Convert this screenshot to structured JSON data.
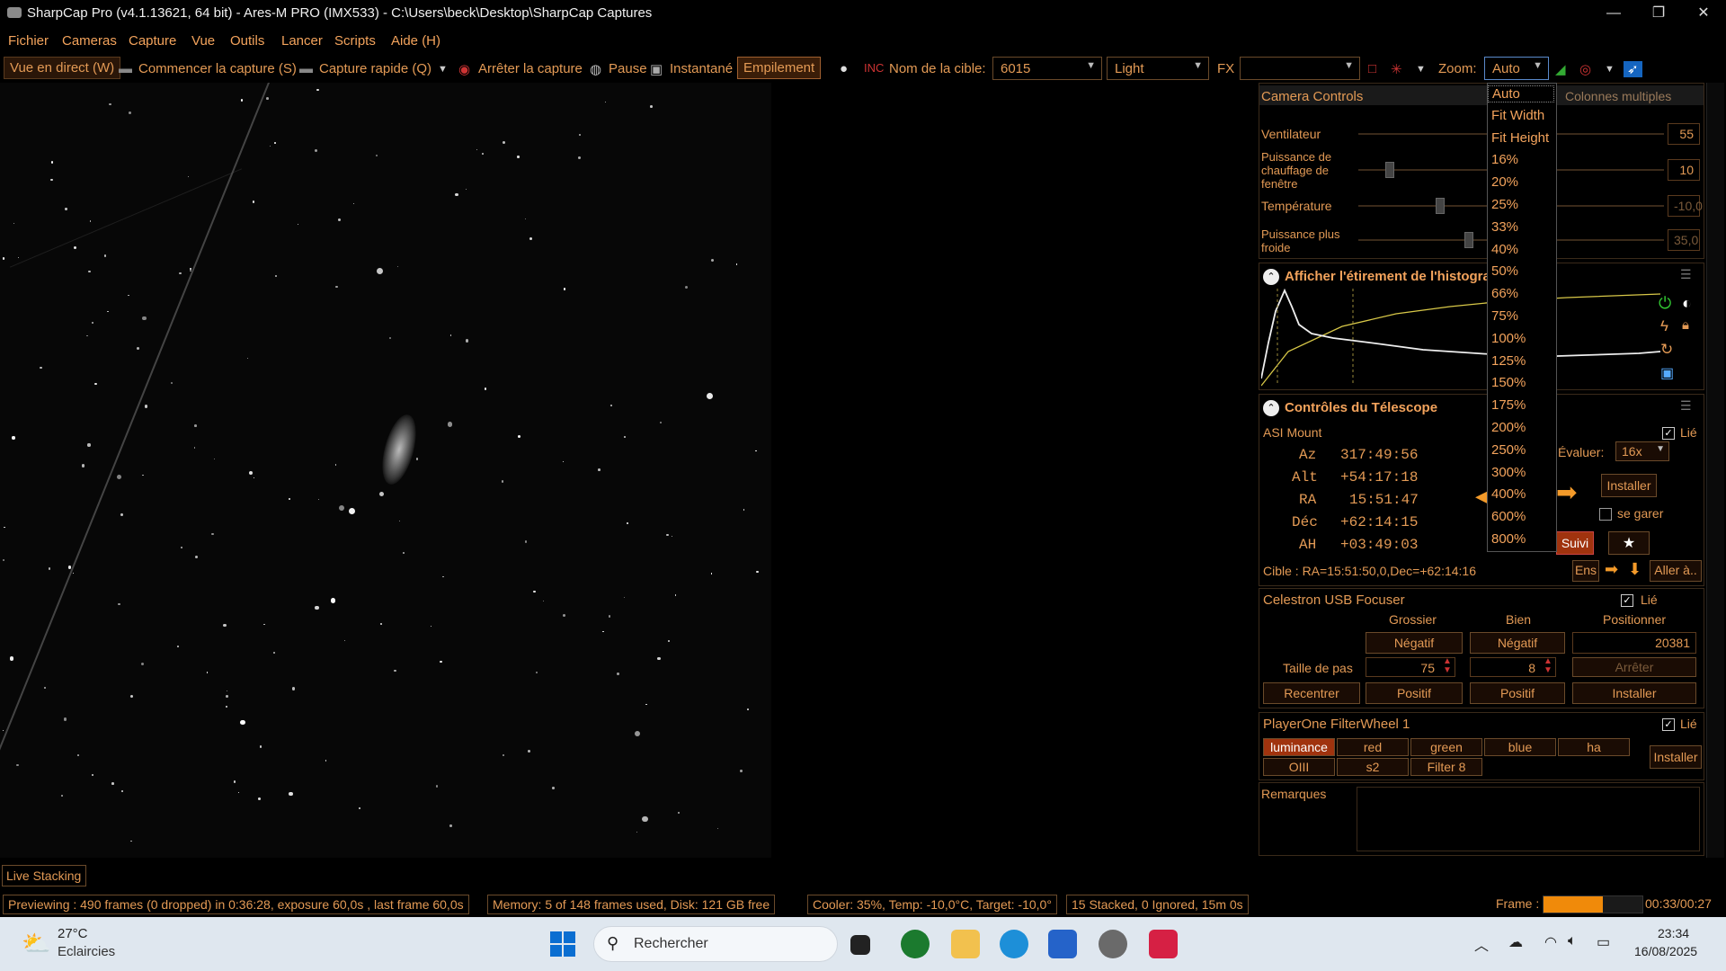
{
  "window": {
    "title": "SharpCap Pro (v4.1.13621, 64 bit) - Ares-M PRO (IMX533) - C:\\Users\\beck\\Desktop\\SharpCap Captures",
    "minimize": "—",
    "maximize": "❐",
    "close": "✕"
  },
  "menu": [
    "Fichier",
    "Cameras",
    "Capture",
    "Vue",
    "Outils",
    "Lancer",
    "Scripts",
    "Aide (H)"
  ],
  "toolbar": {
    "live": "Vue en direct (W)",
    "start_capture": "Commencer la capture (S)",
    "quick_capture": "Capture rapide (Q)",
    "stop_capture": "Arrêter la capture",
    "pause": "Pause",
    "snapshot": "Instantané",
    "stacking": "Empilement",
    "target_label": "Nom de la cible:",
    "target_value": "6015",
    "frame_type": "Light",
    "fx_label": "FX",
    "fx_value": "",
    "zoom_label": "Zoom:",
    "zoom_value": "Auto"
  },
  "zoom_options": [
    "Auto",
    "Fit Width",
    "Fit Height",
    "16%",
    "20%",
    "25%",
    "33%",
    "40%",
    "50%",
    "66%",
    "75%",
    "100%",
    "125%",
    "150%",
    "175%",
    "200%",
    "250%",
    "300%",
    "400%",
    "600%",
    "800%"
  ],
  "camera_controls": {
    "title": "Camera Controls",
    "multi_columns": "Colonnes multiples",
    "fan_label": "Ventilateur",
    "fan_value": "55",
    "window_heater_label": "Puissance de chauffage de fenêtre",
    "window_heater_value": "10",
    "temperature_label": "Température",
    "temperature_value": "-10,0",
    "cooler_label": "Puissance plus froide",
    "cooler_value": "35,0"
  },
  "histogram": {
    "title": "Afficher l'étirement de l'histogram"
  },
  "telescope": {
    "title": "Contrôles du Télescope",
    "mount": "ASI Mount",
    "linked": "Lié",
    "az_label": "Az",
    "az": "317:49:56",
    "alt_label": "Alt",
    "alt": "+54:17:18",
    "ra_label": "RA",
    "ra": "15:51:47",
    "dec_label": "Déc",
    "dec": "+62:14:15",
    "ah_label": "AH",
    "ah": "+03:49:03",
    "evaluate_label": "Évaluer:",
    "evaluate_value": "16x",
    "install": "Installer",
    "park": "se garer",
    "tracking": "Suivi",
    "target": "Cible : RA=15:51:50,0,Dec=+62:14:16",
    "set": "Ens",
    "goto": "Aller à.."
  },
  "focuser": {
    "title": "Celestron USB Focuser",
    "linked": "Lié",
    "coarse": "Grossier",
    "fine": "Bien",
    "position_label": "Positionner",
    "negative": "Négatif",
    "position_value": "20381",
    "step_label": "Taille de pas",
    "coarse_step": "75",
    "fine_step": "8",
    "stop": "Arrêter",
    "recenter": "Recentrer",
    "positive": "Positif",
    "install": "Installer"
  },
  "filterwheel": {
    "title": "PlayerOne FilterWheel 1",
    "linked": "Lié",
    "filters": [
      "luminance",
      "red",
      "green",
      "blue",
      "ha",
      "OIII",
      "s2",
      "Filter 8"
    ],
    "install": "Installer"
  },
  "notes": {
    "label": "Remarques"
  },
  "live_stacking_tab": "Live Stacking",
  "status": {
    "preview": "Previewing : 490 frames (0 dropped) in 0:36:28, exposure 60,0s , last frame 60,0s",
    "memory": "Memory: 5 of 148 frames used, Disk: 121 GB free",
    "cooler": "Cooler: 35%, Temp: -10,0°C, Target: -10,0°",
    "stacked": "15 Stacked, 0 Ignored, 15m 0s",
    "frame_label": "Frame :",
    "frame_time": "00:33/00:27",
    "frame_progress": 0.6
  },
  "taskbar": {
    "temp": "27°C",
    "weather": "Eclaircies",
    "search": "Rechercher",
    "time": "23:34",
    "date": "16/08/2025"
  }
}
